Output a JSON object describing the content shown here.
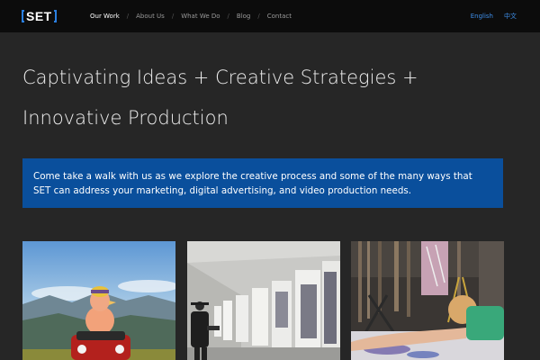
{
  "header": {
    "logo_text": "SET",
    "nav": [
      {
        "label": "Our Work",
        "active": true
      },
      {
        "label": "About Us",
        "active": false
      },
      {
        "label": "What We Do",
        "active": false
      },
      {
        "label": "Blog",
        "active": false
      },
      {
        "label": "Contact",
        "active": false
      }
    ],
    "nav_separator": "/",
    "lang_english": "English",
    "lang_chinese": "中文"
  },
  "main": {
    "headline": "Captivating Ideas + Creative Strategies + Innovative Production",
    "callout": "Come take a walk with us as we explore the creative process and some of the many ways that SET can address your marketing, digital advertising, and video production needs."
  },
  "colors": {
    "header_bg": "#0c0c0c",
    "page_bg": "#262626",
    "callout_bg": "#0a4f9c",
    "accent": "#3e8ee8"
  }
}
